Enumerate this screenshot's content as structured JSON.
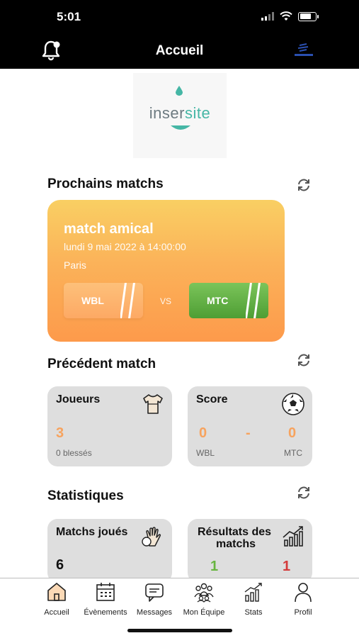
{
  "status": {
    "time": "5:01"
  },
  "header": {
    "title": "Accueil"
  },
  "logo": {
    "part1": "inser",
    "part2": "site"
  },
  "next_matches": {
    "title": "Prochains matchs",
    "match": {
      "name": "match amical",
      "date": "lundi 9 mai 2022 à 14:00:00",
      "place": "Paris",
      "home": "WBL",
      "vs": "VS",
      "away": "MTC"
    }
  },
  "previous_match": {
    "title": "Précédent match",
    "players": {
      "label": "Joueurs",
      "value": "3",
      "injured": "0 blessés"
    },
    "score": {
      "label": "Score",
      "home_score": "0",
      "separator": "-",
      "away_score": "0",
      "home": "WBL",
      "away": "MTC"
    }
  },
  "stats": {
    "title": "Statistiques",
    "played": {
      "label": "Matchs joués",
      "value": "6"
    },
    "results": {
      "label_line1": "Résultats des",
      "label_line2": "matchs",
      "wins": "1",
      "losses": "1"
    }
  },
  "tabs": [
    {
      "label": "Accueil",
      "icon": "home-icon"
    },
    {
      "label": "Évènements",
      "icon": "calendar-icon"
    },
    {
      "label": "Messages",
      "icon": "message-icon"
    },
    {
      "label": "Mon Équipe",
      "icon": "team-icon"
    },
    {
      "label": "Stats",
      "icon": "stats-icon"
    },
    {
      "label": "Profil",
      "icon": "profile-icon"
    }
  ],
  "colors": {
    "accent": "#fbb259",
    "green": "#68b540",
    "red": "#d43a3a"
  }
}
